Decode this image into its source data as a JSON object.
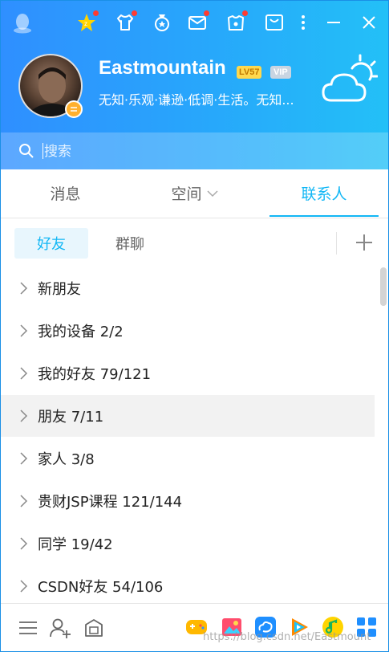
{
  "titlebar": {
    "icons": [
      {
        "name": "qq-level-icon",
        "badge": true
      },
      {
        "name": "shirt-icon",
        "badge": true
      },
      {
        "name": "medal-icon",
        "badge": false
      },
      {
        "name": "mail-icon",
        "badge": true
      },
      {
        "name": "gift-shop-icon",
        "badge": true
      },
      {
        "name": "wallet-icon",
        "badge": false
      }
    ]
  },
  "profile": {
    "nickname": "Eastmountain",
    "level_badge": "LV57",
    "vip_badge": "VIP",
    "signature": "无知·乐观·谦逊·低调·生活。无知..."
  },
  "search": {
    "placeholder": "搜索"
  },
  "tabs": [
    {
      "label": "消息",
      "active": false
    },
    {
      "label": "空间",
      "active": false,
      "dropdown": true
    },
    {
      "label": "联系人",
      "active": true
    }
  ],
  "subtabs": [
    {
      "label": "好友",
      "active": true
    },
    {
      "label": "群聊",
      "active": false
    }
  ],
  "groups": [
    {
      "label": "新朋友"
    },
    {
      "label": "我的设备 2/2"
    },
    {
      "label": "我的好友 79/121"
    },
    {
      "label": "朋友 7/11",
      "hover": true
    },
    {
      "label": "家人 3/8"
    },
    {
      "label": "贵财JSP课程 121/144"
    },
    {
      "label": "同学 19/42"
    },
    {
      "label": "CSDN好友 54/106"
    }
  ],
  "watermark": "https://blog.csdn.net/Eastmount",
  "colors": {
    "accent": "#12b7f5",
    "header_start": "#2f8fff",
    "header_end": "#23c0f7"
  }
}
